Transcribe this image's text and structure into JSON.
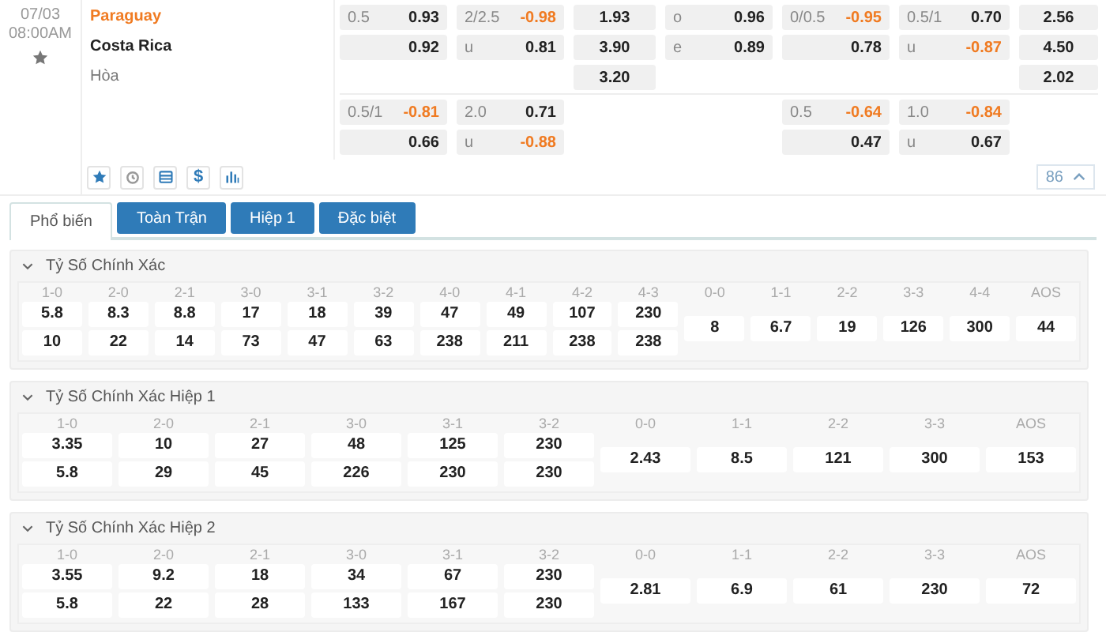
{
  "match": {
    "date": "07/03",
    "time": "08:00AM",
    "home_team": "Paraguay",
    "away_team": "Costa Rica",
    "draw_label": "Hòa",
    "lines": [
      {
        "handicap": [
          {
            "label": "0.5",
            "value": "0.93",
            "negative": false
          },
          {
            "value": "0.92",
            "negative": false
          }
        ],
        "over_under": [
          {
            "label": "2/2.5",
            "value": "-0.98",
            "negative": true
          },
          {
            "label": "u",
            "value": "0.81",
            "negative": false
          }
        ],
        "x12": [
          {
            "value": "1.93",
            "negative": false
          },
          {
            "value": "3.90",
            "negative": false
          },
          {
            "value": "3.20",
            "negative": false
          }
        ],
        "odd_even": [
          {
            "label": "o",
            "value": "0.96",
            "negative": false
          },
          {
            "label": "e",
            "value": "0.89",
            "negative": false
          }
        ],
        "h1_handicap": [
          {
            "label": "0/0.5",
            "value": "-0.95",
            "negative": true
          },
          {
            "value": "0.78",
            "negative": false
          }
        ],
        "h1_over_under": [
          {
            "label": "0.5/1",
            "value": "0.70",
            "negative": false
          },
          {
            "label": "u",
            "value": "-0.87",
            "negative": true
          }
        ],
        "h1_x12": [
          {
            "value": "2.56",
            "negative": false
          },
          {
            "value": "4.50",
            "negative": false
          },
          {
            "value": "2.02",
            "negative": false
          }
        ]
      },
      {
        "handicap": [
          {
            "label": "0.5/1",
            "value": "-0.81",
            "negative": true
          },
          {
            "value": "0.66",
            "negative": false
          }
        ],
        "over_under": [
          {
            "label": "2.0",
            "value": "0.71",
            "negative": false
          },
          {
            "label": "u",
            "value": "-0.88",
            "negative": true
          }
        ],
        "h1_handicap": [
          {
            "label": "0.5",
            "value": "-0.64",
            "negative": true
          },
          {
            "value": "0.47",
            "negative": false
          }
        ],
        "h1_over_under": [
          {
            "label": "1.0",
            "value": "-0.84",
            "negative": true
          },
          {
            "label": "u",
            "value": "0.67",
            "negative": false
          }
        ]
      }
    ],
    "currency_symbol": "$",
    "more_count": "86"
  },
  "tabs": [
    {
      "label": "Phổ biến",
      "selected": true
    },
    {
      "label": "Toàn Trận",
      "selected": false
    },
    {
      "label": "Hiệp 1",
      "selected": false
    },
    {
      "label": "Đặc biệt",
      "selected": false
    }
  ],
  "sections": [
    {
      "title": "Tỷ Số Chính Xác",
      "expanded": true,
      "columns": [
        {
          "label": "1-0",
          "values": [
            "5.8",
            "10"
          ]
        },
        {
          "label": "2-0",
          "values": [
            "8.3",
            "22"
          ]
        },
        {
          "label": "2-1",
          "values": [
            "8.8",
            "14"
          ]
        },
        {
          "label": "3-0",
          "values": [
            "17",
            "73"
          ]
        },
        {
          "label": "3-1",
          "values": [
            "18",
            "47"
          ]
        },
        {
          "label": "3-2",
          "values": [
            "39",
            "63"
          ]
        },
        {
          "label": "4-0",
          "values": [
            "47",
            "238"
          ]
        },
        {
          "label": "4-1",
          "values": [
            "49",
            "211"
          ]
        },
        {
          "label": "4-2",
          "values": [
            "107",
            "238"
          ]
        },
        {
          "label": "4-3",
          "values": [
            "230",
            "238"
          ]
        },
        {
          "label": "0-0",
          "values": [
            "8"
          ]
        },
        {
          "label": "1-1",
          "values": [
            "6.7"
          ]
        },
        {
          "label": "2-2",
          "values": [
            "19"
          ]
        },
        {
          "label": "3-3",
          "values": [
            "126"
          ]
        },
        {
          "label": "4-4",
          "values": [
            "300"
          ]
        },
        {
          "label": "AOS",
          "values": [
            "44"
          ]
        }
      ]
    },
    {
      "title": "Tỷ Số Chính Xác Hiệp 1",
      "expanded": true,
      "columns": [
        {
          "label": "1-0",
          "values": [
            "3.35",
            "5.8"
          ]
        },
        {
          "label": "2-0",
          "values": [
            "10",
            "29"
          ]
        },
        {
          "label": "2-1",
          "values": [
            "27",
            "45"
          ]
        },
        {
          "label": "3-0",
          "values": [
            "48",
            "226"
          ]
        },
        {
          "label": "3-1",
          "values": [
            "125",
            "230"
          ]
        },
        {
          "label": "3-2",
          "values": [
            "230",
            "230"
          ]
        },
        {
          "label": "0-0",
          "values": [
            "2.43"
          ]
        },
        {
          "label": "1-1",
          "values": [
            "8.5"
          ]
        },
        {
          "label": "2-2",
          "values": [
            "121"
          ]
        },
        {
          "label": "3-3",
          "values": [
            "300"
          ]
        },
        {
          "label": "AOS",
          "values": [
            "153"
          ]
        }
      ]
    },
    {
      "title": "Tỷ Số Chính Xác Hiệp 2",
      "expanded": true,
      "columns": [
        {
          "label": "1-0",
          "values": [
            "3.55",
            "5.8"
          ]
        },
        {
          "label": "2-0",
          "values": [
            "9.2",
            "22"
          ]
        },
        {
          "label": "2-1",
          "values": [
            "18",
            "28"
          ]
        },
        {
          "label": "3-0",
          "values": [
            "34",
            "133"
          ]
        },
        {
          "label": "3-1",
          "values": [
            "67",
            "167"
          ]
        },
        {
          "label": "3-2",
          "values": [
            "230",
            "230"
          ]
        },
        {
          "label": "0-0",
          "values": [
            "2.81"
          ]
        },
        {
          "label": "1-1",
          "values": [
            "6.9"
          ]
        },
        {
          "label": "2-2",
          "values": [
            "61"
          ]
        },
        {
          "label": "3-3",
          "values": [
            "230"
          ]
        },
        {
          "label": "AOS",
          "values": [
            "72"
          ]
        }
      ]
    }
  ]
}
